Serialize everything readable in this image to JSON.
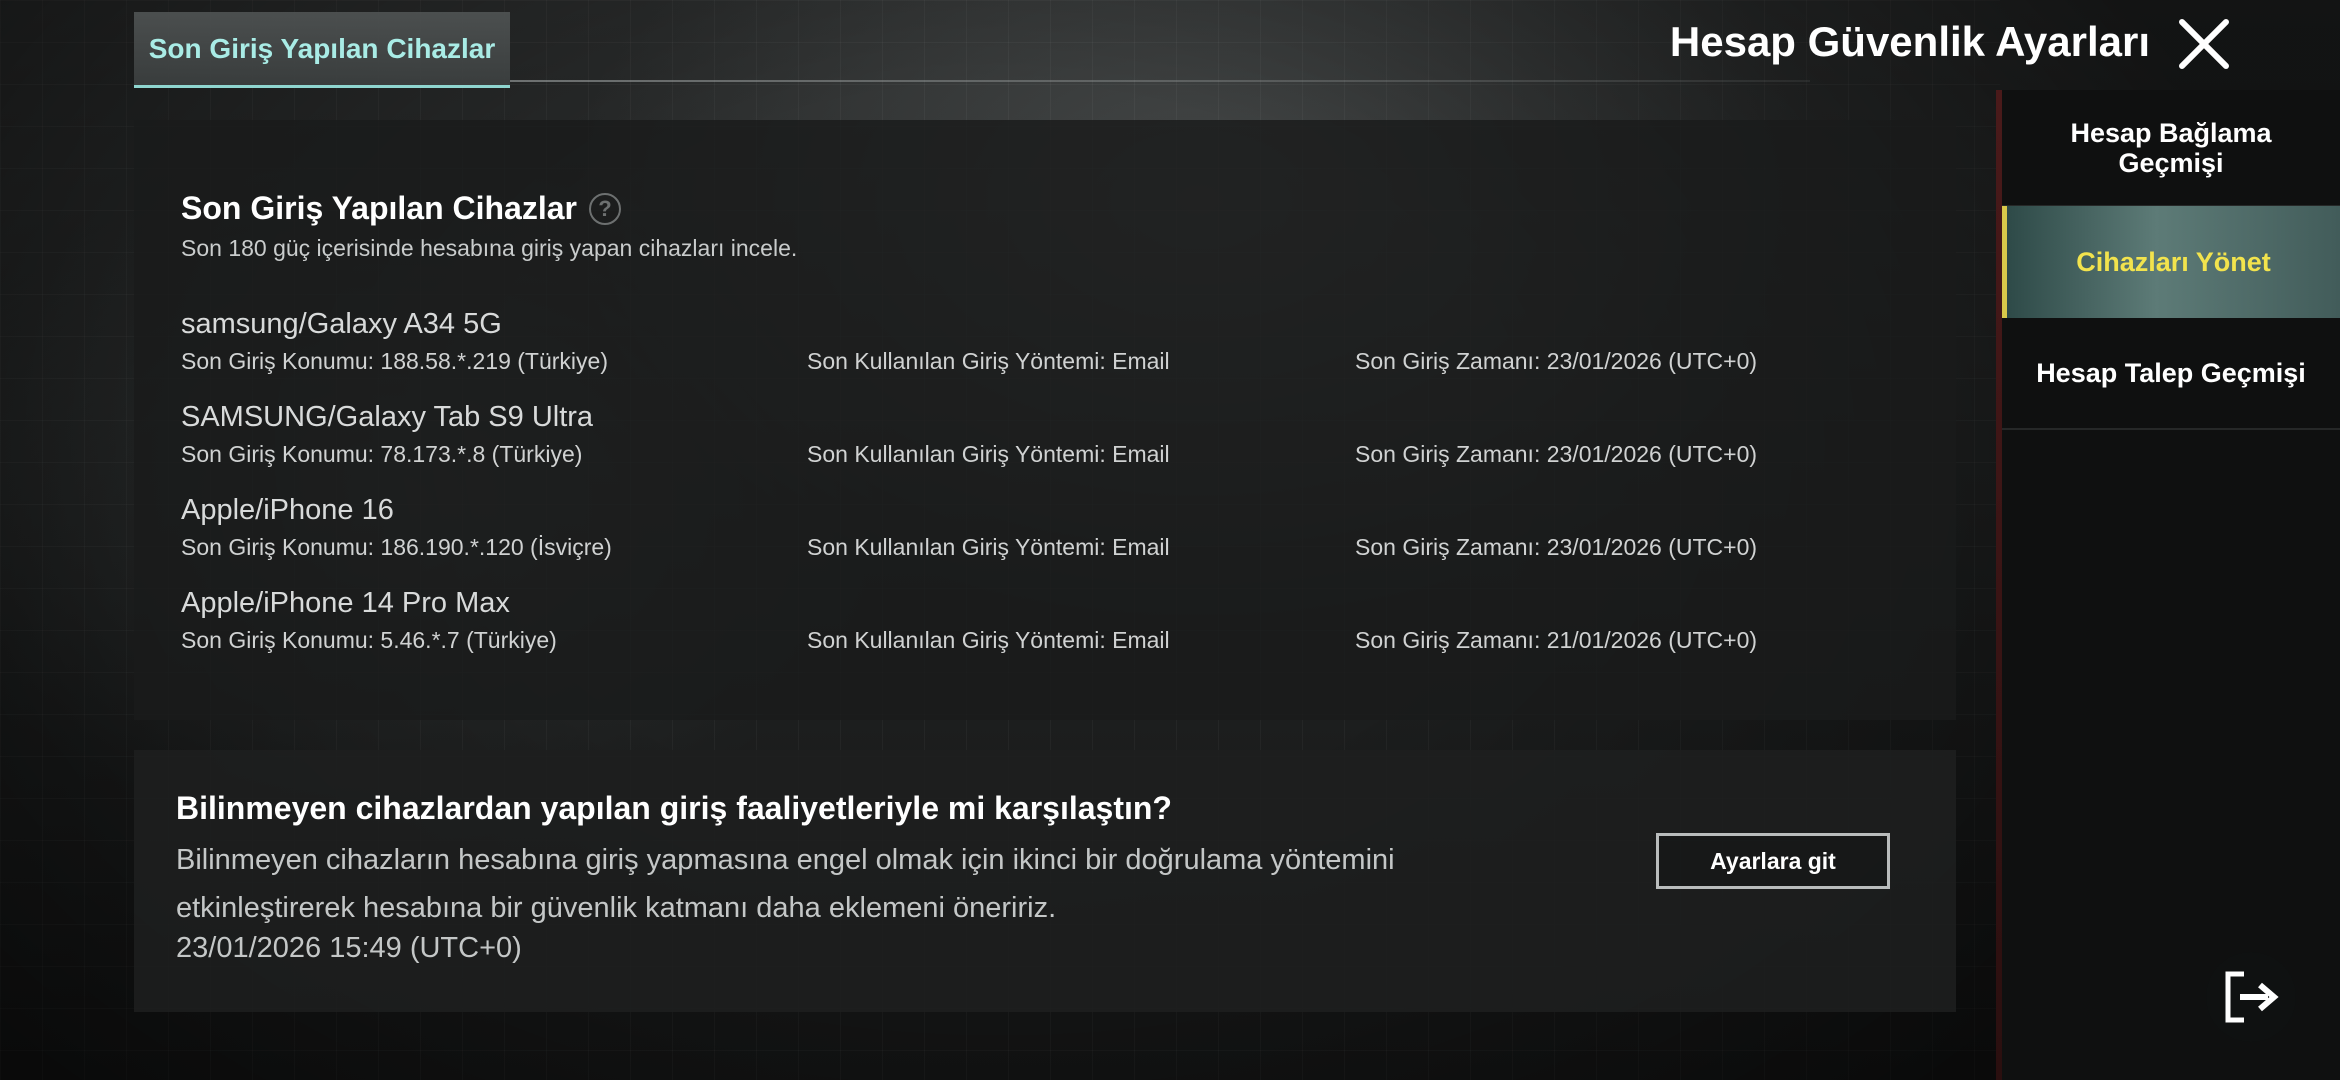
{
  "header": {
    "tab_label": "Son Giriş Yapılan Cihazlar",
    "title": "Hesap Güvenlik Ayarları",
    "close_icon": "close-icon"
  },
  "devices_panel": {
    "heading": "Son Giriş Yapılan Cihazlar",
    "help_icon": "question-circle-icon",
    "help_glyph": "?",
    "subtitle": "Son 180 güç içerisinde hesabına giriş yapan cihazları incele.",
    "devices": [
      {
        "name": "samsung/Galaxy A34 5G",
        "location": "Son Giriş Konumu: 188.58.*.219 (Türkiye)",
        "method": "Son Kullanılan Giriş Yöntemi: Email",
        "time": "Son Giriş Zamanı: 23/01/2026 (UTC+0)"
      },
      {
        "name": "SAMSUNG/Galaxy Tab S9 Ultra",
        "location": "Son Giriş Konumu: 78.173.*.8 (Türkiye)",
        "method": "Son Kullanılan Giriş Yöntemi: Email",
        "time": "Son Giriş Zamanı: 23/01/2026 (UTC+0)"
      },
      {
        "name": "Apple/iPhone 16",
        "location": "Son Giriş Konumu: 186.190.*.120 (İsviçre)",
        "method": "Son Kullanılan Giriş Yöntemi: Email",
        "time": "Son Giriş Zamanı: 23/01/2026 (UTC+0)"
      },
      {
        "name": "Apple/iPhone 14 Pro Max",
        "location": "Son Giriş Konumu: 5.46.*.7 (Türkiye)",
        "method": "Son Kullanılan Giriş Yöntemi: Email",
        "time": "Son Giriş Zamanı: 21/01/2026 (UTC+0)"
      }
    ]
  },
  "notice": {
    "title": "Bilinmeyen cihazlardan yapılan giriş faaliyetleriyle mi karşılaştın?",
    "body": "Bilinmeyen cihazların hesabına giriş yapmasına engel olmak için ikinci bir doğrulama yöntemini etkinleştirerek hesabına bir güvenlik katmanı daha eklemeni öneririz.",
    "date": "23/01/2026 15:49 (UTC+0)",
    "button_label": "Ayarlara git"
  },
  "sidebar": {
    "items": [
      {
        "label": "Hesap Bağlama Geçmişi",
        "active": false
      },
      {
        "label": "Cihazları Yönet",
        "active": true
      },
      {
        "label": "Hesap Talep Geçmişi",
        "active": false
      }
    ],
    "active_color": "#f2e34d"
  },
  "logout": {
    "icon": "logout-icon"
  }
}
